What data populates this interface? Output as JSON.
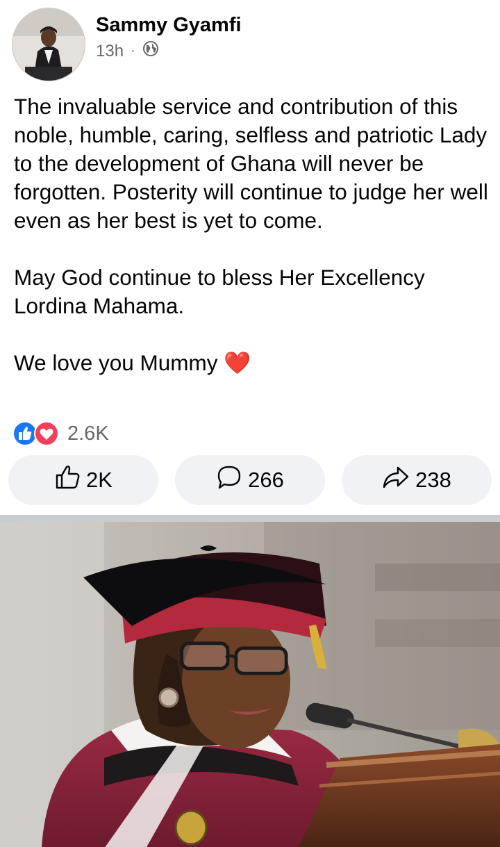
{
  "post": {
    "author": "Sammy Gyamfi",
    "time": "13h",
    "separator": "·",
    "privacy_icon": "globe-icon",
    "paragraphs": [
      "The invaluable service and contribution of this noble, humble, caring, selfless and patriotic Lady to the development of Ghana will never be forgotten. Posterity will continue to judge her well even as her best is yet to come.",
      "May God continue to bless Her Excellency Lordina Mahama.",
      "We love you Mummy ❤️"
    ]
  },
  "reactions": {
    "icons": [
      "like-icon",
      "love-icon"
    ],
    "total": "2.6K"
  },
  "actions": {
    "like": {
      "icon": "thumbs-up-icon",
      "count": "2K"
    },
    "comment": {
      "icon": "comment-bubble-icon",
      "count": "266"
    },
    "share": {
      "icon": "share-arrow-icon",
      "count": "238"
    }
  },
  "colors": {
    "like_blue": "#1877f2",
    "love_red": "#f33e58",
    "secondary_text": "#65676b",
    "button_bg": "#f0f2f5",
    "divider": "#c9ccd1"
  }
}
